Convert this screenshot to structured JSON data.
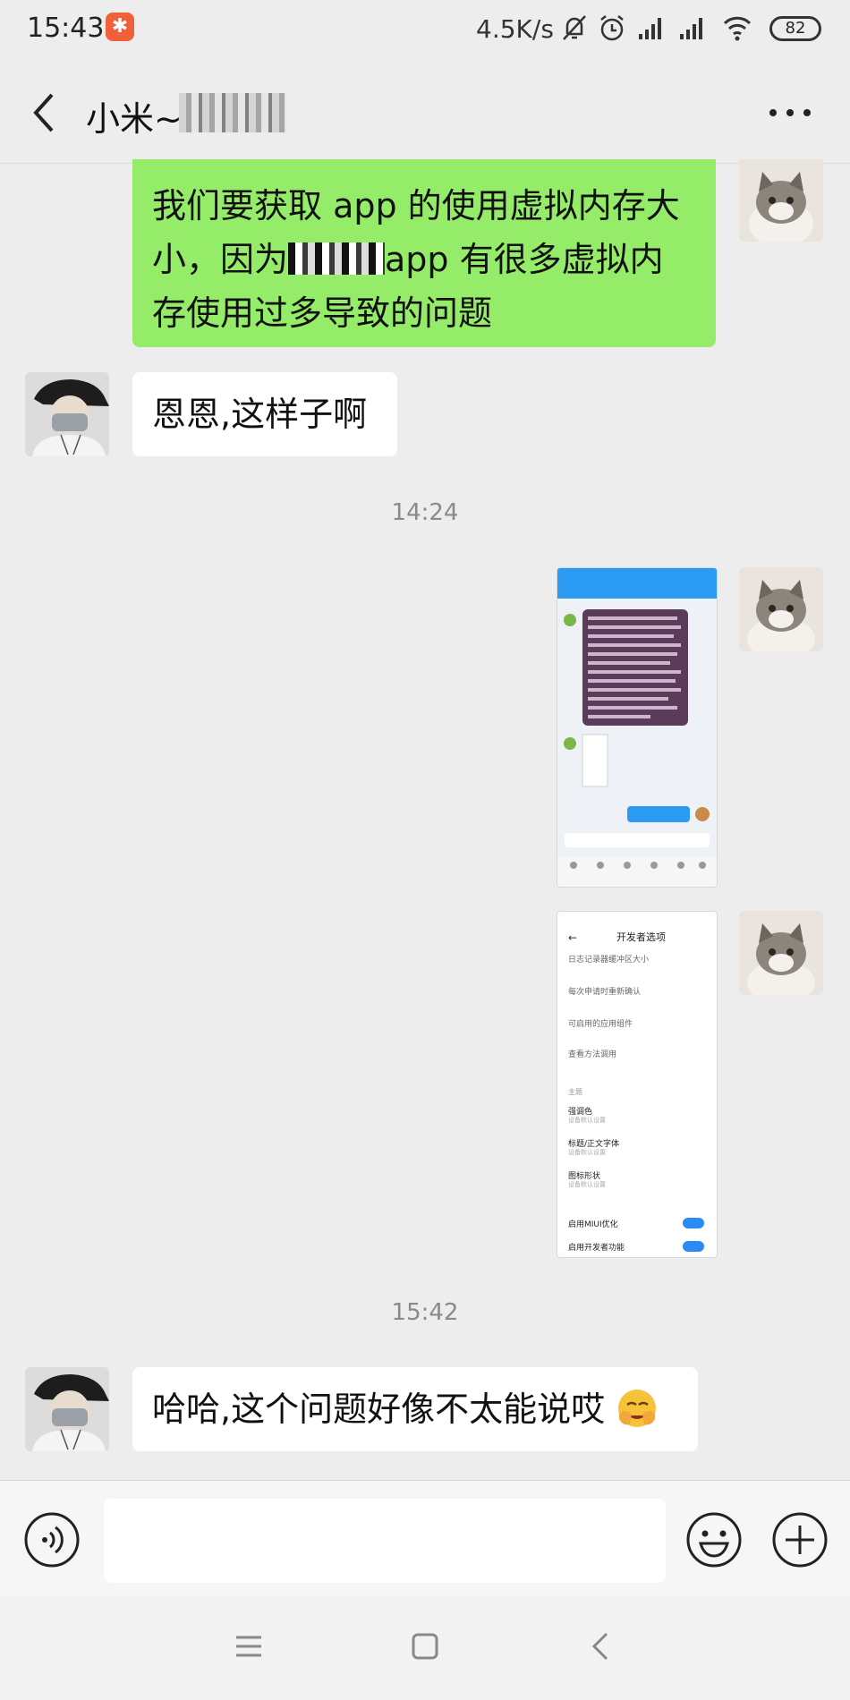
{
  "status_bar": {
    "time": "15:43",
    "network_speed": "4.5K/s",
    "battery": "82",
    "icons": [
      "app-notification-icon",
      "mute-bell-icon",
      "alarm-icon",
      "signal-icon",
      "signal-icon",
      "wifi-icon",
      "battery-icon"
    ]
  },
  "header": {
    "title": "小米~",
    "back_icon": "chevron-left-icon",
    "more_icon": "more-dots-icon"
  },
  "messages": [
    {
      "side": "right",
      "type": "text",
      "parts": [
        "我们要获取 app 的使用虚拟内存大小，因为",
        "app 有很多虚拟内存使用过多导致的问题"
      ]
    },
    {
      "side": "left",
      "type": "text",
      "text": "恩恩,这样子啊"
    },
    {
      "type": "timestamp",
      "text": "14:24"
    },
    {
      "side": "right",
      "type": "image",
      "description": "chat-screenshot"
    },
    {
      "side": "right",
      "type": "image",
      "description": "developer-options-screenshot"
    },
    {
      "type": "timestamp",
      "text": "15:42"
    },
    {
      "side": "left",
      "type": "text",
      "text": "哈哈,这个问题好像不太能说哎",
      "emoji": "facepalm-emoji-icon"
    }
  ],
  "screenshot2": {
    "title": "开发者选项",
    "rows": [
      "日志记录器缓冲区大小",
      "每次申请时重新确认",
      "可启用的应用组件",
      "查看方法调用"
    ],
    "section": "主题",
    "items": [
      {
        "label": "强调色",
        "sub": "设备默认设置"
      },
      {
        "label": "标题/正文字体",
        "sub": "设备默认设置"
      },
      {
        "label": "图标形状",
        "sub": "设备默认设置"
      }
    ],
    "toggles": [
      "启用MIUI优化",
      "启用开发者功能"
    ]
  },
  "input_bar": {
    "voice_icon": "voice-icon",
    "emoji_icon": "emoji-icon",
    "plus_icon": "plus-icon"
  },
  "nav_bar": {
    "icons": [
      "menu-icon",
      "home-icon",
      "back-icon"
    ]
  },
  "colors": {
    "background": "#ededed",
    "sent_bubble": "#95ec69",
    "received_bubble": "#ffffff"
  }
}
